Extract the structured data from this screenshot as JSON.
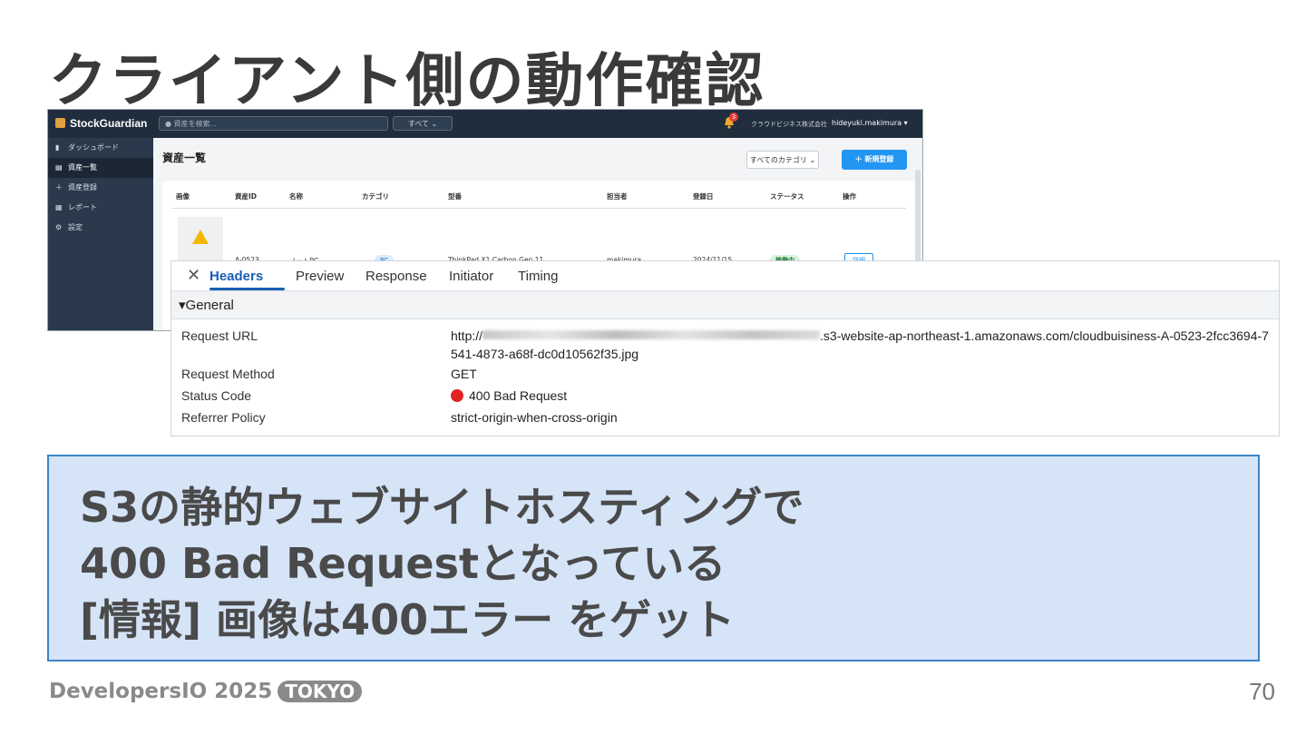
{
  "slide": {
    "title": "クライアント側の動作確認",
    "footer_brand": "DevelopersIO 2025",
    "footer_badge": "TOKYO",
    "page_number": "70"
  },
  "app": {
    "brand": "StockGuardian",
    "search_placeholder": "資産を検索...",
    "scope_select": "すべて",
    "notification_count": "3",
    "company": "クラウドビジネス株式会社",
    "user": "hideyuki.makimura ▾",
    "sidebar": [
      {
        "label": "ダッシュボード",
        "icon": "dashboard-icon"
      },
      {
        "label": "資産一覧",
        "icon": "list-icon",
        "active": true
      },
      {
        "label": "資産登録",
        "icon": "plus-icon"
      },
      {
        "label": "レポート",
        "icon": "report-icon"
      },
      {
        "label": "設定",
        "icon": "gear-icon"
      }
    ],
    "page_title": "資産一覧",
    "category_select": "すべてのカテゴリ",
    "new_button": "＋ 新規登録",
    "table": {
      "headers": [
        "画像",
        "資産ID",
        "名称",
        "カテゴリ",
        "型番",
        "担当者",
        "登録日",
        "ステータス",
        "操作"
      ],
      "row": {
        "id": "A-0523",
        "name": "ノートPC",
        "category": "PC",
        "model": "ThinkPad X1 Carbon Gen 11",
        "owner": "makimura",
        "date": "2024/11/15",
        "status": "稼働中",
        "action": "詳細"
      }
    }
  },
  "devtools": {
    "tabs": [
      "Headers",
      "Preview",
      "Response",
      "Initiator",
      "Timing"
    ],
    "active_tab": "Headers",
    "section": "▾General",
    "rows": [
      {
        "key": "Request URL",
        "value_prefix": "http://",
        "value_suffix": ".s3-website-ap-northeast-1.amazonaws.com/cloudbuisiness-A-0523-2fcc3694-7",
        "value_line2": "541-4873-a68f-dc0d10562f35.jpg"
      },
      {
        "key": "Request Method",
        "value": "GET"
      },
      {
        "key": "Status Code",
        "value": "400 Bad Request"
      },
      {
        "key": "Referrer Policy",
        "value": "strict-origin-when-cross-origin"
      }
    ]
  },
  "callout": {
    "line1": "S3の静的ウェブサイトホスティングで",
    "line2": "400 Bad Requestとなっている",
    "line3": "[情報] 画像は400エラー をゲット"
  }
}
